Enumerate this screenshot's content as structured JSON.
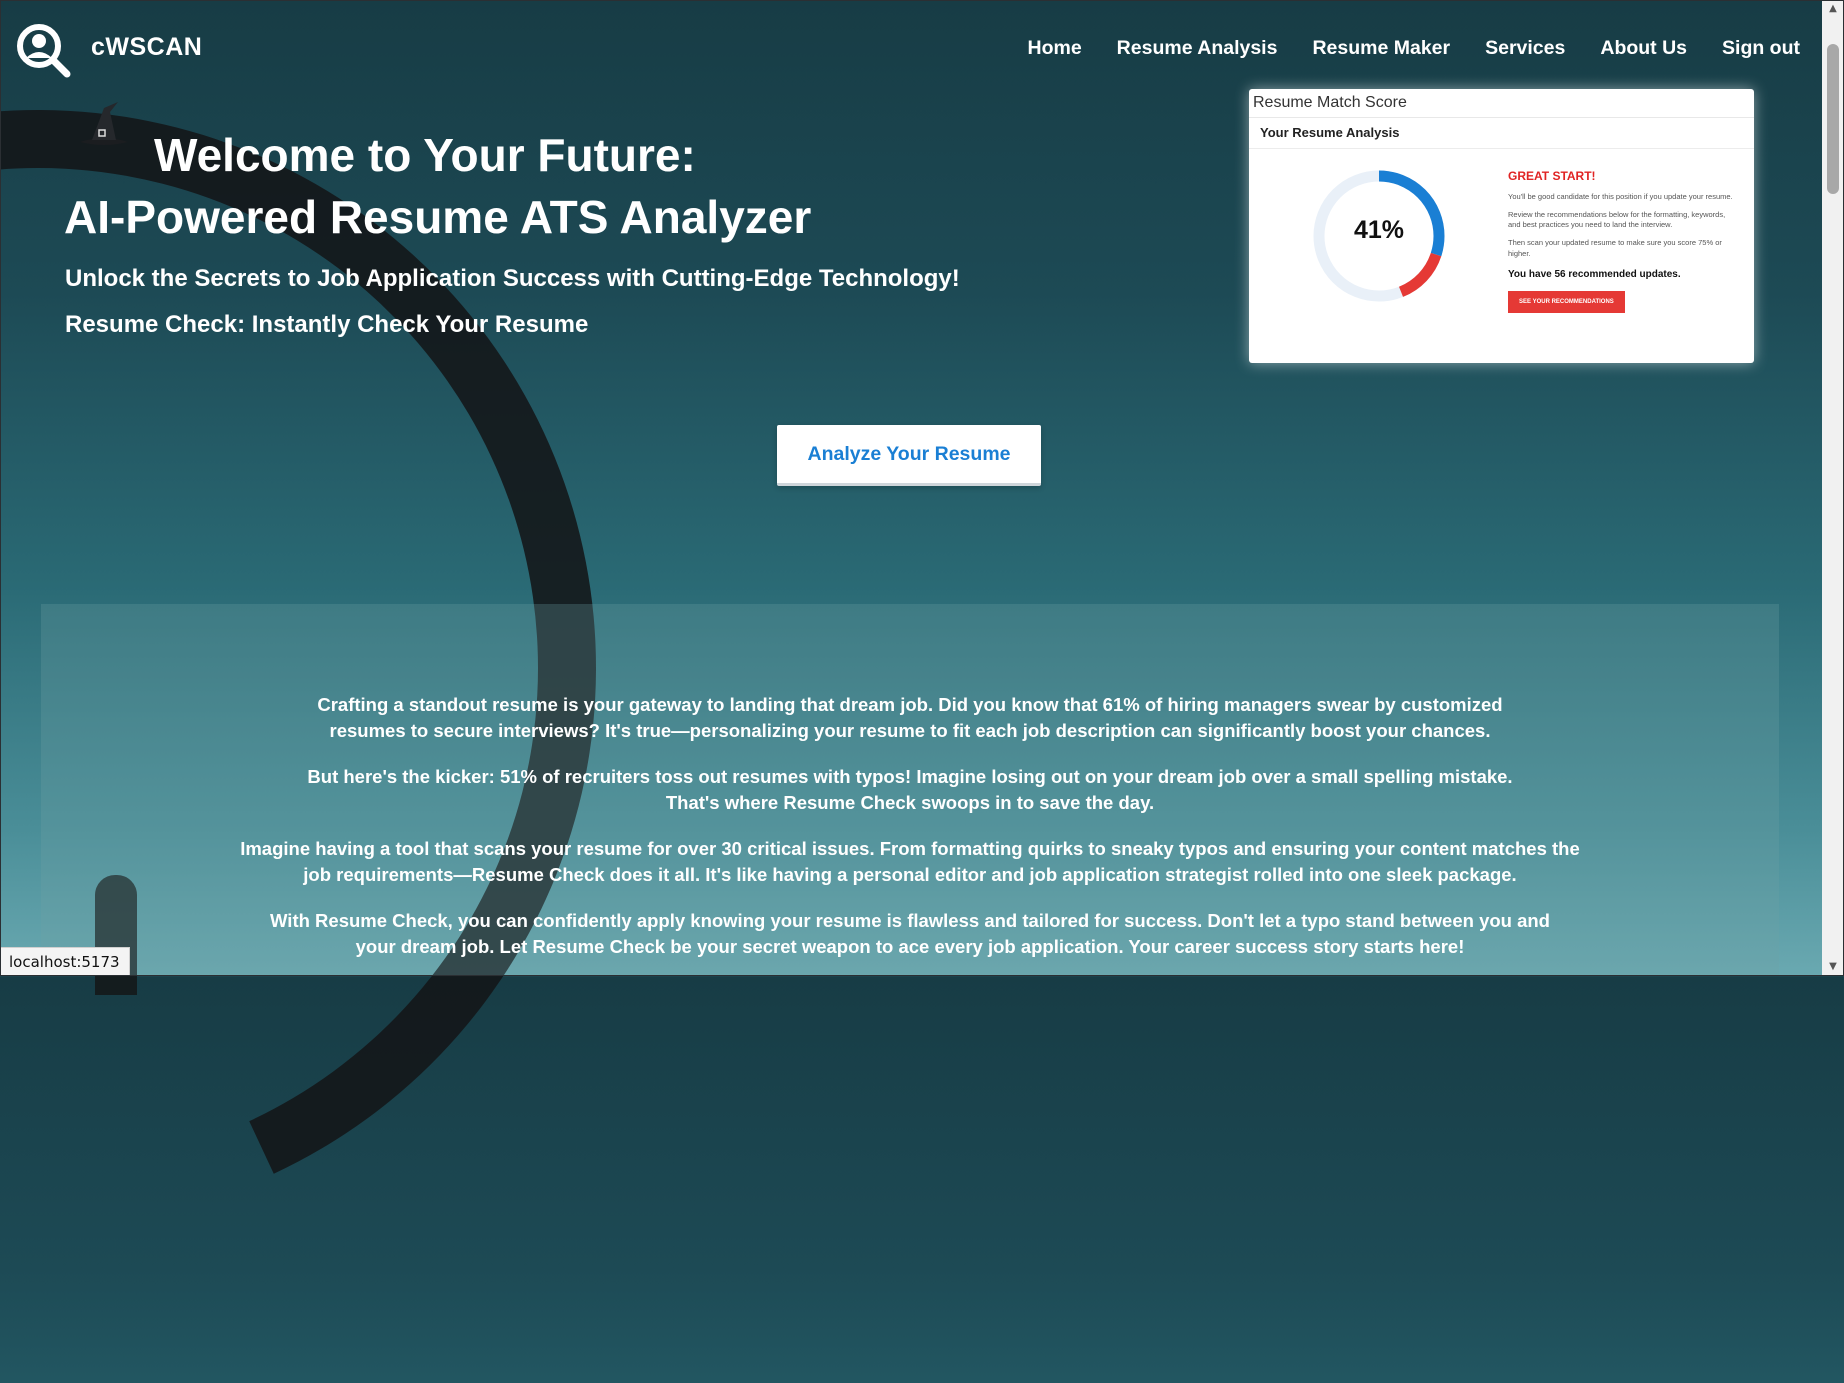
{
  "header": {
    "brand": "cWSCAN",
    "logo_icon": "search-person-icon",
    "nav": [
      "Home",
      "Resume Analysis",
      "Resume Maker",
      "Services",
      "About Us",
      "Sign out"
    ]
  },
  "hero": {
    "title_line1": "Welcome to Your Future:",
    "title_line2": "AI-Powered Resume ATS Analyzer",
    "subtitle1": "Unlock the Secrets to Job Application Success with Cutting-Edge Technology!",
    "subtitle2": "Resume Check: Instantly Check Your Resume",
    "cta_label": "Analyze Your Resume",
    "decoration_icon": "witch-hat-icon"
  },
  "score_card": {
    "header": "Resume Match Score",
    "subheader": "Your Resume Analysis",
    "score_value": "41%",
    "score_fraction": 0.41,
    "status_title": "GREAT START!",
    "text1": "You'll be good candidate for this position if you update your resume.",
    "text2": "Review the recommendations below for the formatting, keywords, and best practices you need to land the interview.",
    "text3": "Then scan your updated resume to make sure you score 75% or higher.",
    "updates": "You have 56 recommended updates.",
    "button": "SEE YOUR RECOMMENDATIONS",
    "colors": {
      "primary": "#1a7fd4",
      "alert": "#e53935",
      "track": "#e9f0f8"
    }
  },
  "info": {
    "paragraphs": [
      "Crafting a standout resume is your gateway to landing that dream job. Did you know that 61% of hiring managers swear by customized resumes to secure interviews? It's true—personalizing your resume to fit each job description can significantly boost your chances.",
      "But here's the kicker: 51% of recruiters toss out resumes with typos! Imagine losing out on your dream job over a small spelling mistake. That's where Resume Check swoops in to save the day.",
      "Imagine having a tool that scans your resume for over 30 critical issues. From formatting quirks to sneaky typos and ensuring your content matches the job requirements—Resume Check does it all. It's like having a personal editor and job application strategist rolled into one sleek package.",
      "With Resume Check, you can confidently apply knowing your resume is flawless and tailored for success. Don't let a typo stand between you and your dream job. Let Resume Check be your secret weapon to ace every job application. Your career success story starts here!"
    ]
  },
  "status_bar": {
    "url": "localhost:5173"
  },
  "scrollbar": {
    "up_icon": "▲",
    "down_icon": "▼"
  }
}
